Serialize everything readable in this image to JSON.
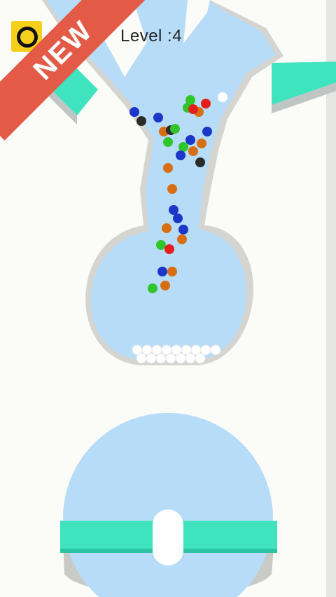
{
  "hud": {
    "level_label": "Level :4",
    "badge_text": "NEW"
  },
  "colors": {
    "background": "#fbfbf8",
    "water": "#b7dcf7",
    "track_rim": "#d4d4d1",
    "platform": "#3fe3bd",
    "banner": "#e35b46",
    "logo": "#f6cf1b"
  },
  "balls": [
    {
      "c": "#30c52a"
    },
    {
      "c": "#ffffff"
    },
    {
      "c": "#e51d1d"
    },
    {
      "c": "#d86e14"
    },
    {
      "c": "#1c36c8"
    },
    {
      "c": "#2b2b2b"
    },
    {
      "c": "#30c52a"
    },
    {
      "c": "#1c36c8"
    },
    {
      "c": "#d86e14"
    },
    {
      "c": "#2b2b2b"
    },
    {
      "c": "#30c52a"
    },
    {
      "c": "#1c36c8"
    },
    {
      "c": "#d86e14"
    },
    {
      "c": "#30c52a"
    },
    {
      "c": "#1c36c8"
    },
    {
      "c": "#d86e14"
    },
    {
      "c": "#2b2b2b"
    },
    {
      "c": "#30c52a"
    },
    {
      "c": "#1c36c8"
    },
    {
      "c": "#d86e14"
    },
    {
      "c": "#e51d1d"
    },
    {
      "c": "#d86e14"
    },
    {
      "c": "#1c36c8"
    },
    {
      "c": "#d86e14"
    },
    {
      "c": "#30c52a"
    },
    {
      "c": "#1c36c8"
    },
    {
      "c": "#d86e14"
    },
    {
      "c": "#e51d1d"
    },
    {
      "c": "#1c36c8"
    },
    {
      "c": "#d86e14"
    },
    {
      "c": "#30c52a"
    },
    {
      "c": "#d86e14"
    },
    {
      "c": "#1c36c8"
    }
  ],
  "collected_balls": 16
}
